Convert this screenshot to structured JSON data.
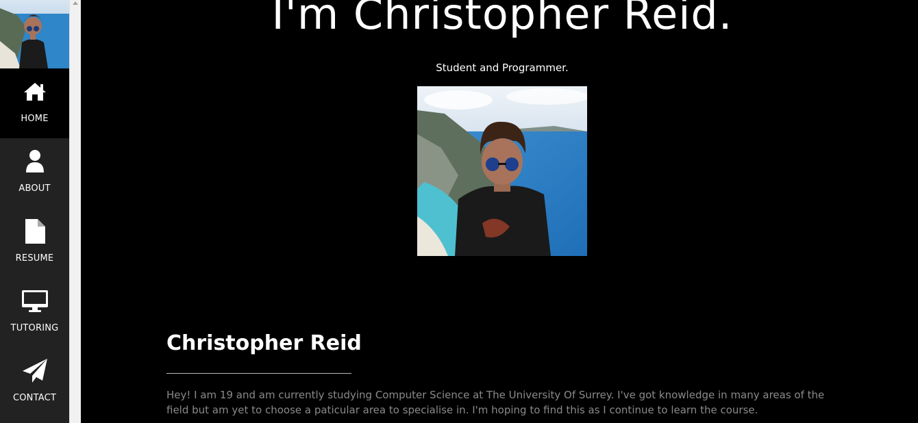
{
  "sidebar": {
    "items": [
      {
        "label": "HOME",
        "icon": "home-icon",
        "active": true
      },
      {
        "label": "ABOUT",
        "icon": "user-icon",
        "active": false
      },
      {
        "label": "RESUME",
        "icon": "file-icon",
        "active": false
      },
      {
        "label": "TUTORING",
        "icon": "desktop-icon",
        "active": false
      },
      {
        "label": "CONTACT",
        "icon": "paper-plane-icon",
        "active": false
      }
    ]
  },
  "hero": {
    "title": "I'm Christopher Reid.",
    "subtitle": "Student and Programmer."
  },
  "about": {
    "name": "Christopher Reid",
    "text": "Hey! I am 19 and am currently studying Computer Science at The University Of Surrey. I've got knowledge in many areas of the field but am yet to choose a paticular area to specialise in. I'm hoping to find this as I continue to learn the course."
  },
  "colors": {
    "sidebar_bg": "#222222",
    "active_bg": "#000000",
    "page_bg": "#000000",
    "body_text": "#8a8a8a"
  }
}
